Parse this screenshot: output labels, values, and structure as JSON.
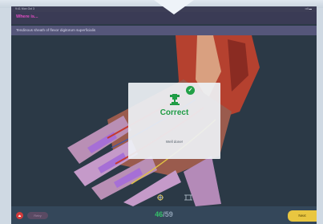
{
  "statusbar": {
    "time": "9:41 Mon Oct 3",
    "indicators": "••il ▬"
  },
  "header": {
    "title": "Where is..."
  },
  "question": {
    "prompt": "Tendinous sheath of flexor digitorum superficialis"
  },
  "result": {
    "heading": "Correct",
    "message": "Well done!",
    "check_icon": "check-icon",
    "trophy_icon": "trophy-icon"
  },
  "tools": {
    "rotate_icon": "rotate-icon",
    "fit_icon": "fit-view-icon"
  },
  "footer": {
    "exit_label": "⏏",
    "retry_label": "Retry",
    "progress": {
      "current": "46",
      "separator": "/",
      "total": "59"
    },
    "next_label": "Next"
  },
  "colors": {
    "correct_green": "#1f9c45",
    "header_magenta": "#e24cc4",
    "next_yellow": "#e9c640",
    "sheath_purple": "#a66fd6"
  }
}
